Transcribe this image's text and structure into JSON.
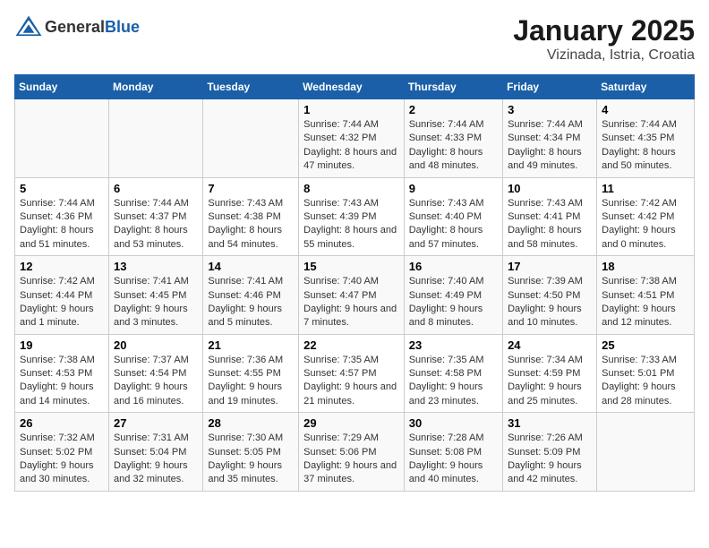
{
  "header": {
    "logo": {
      "general": "General",
      "blue": "Blue"
    },
    "title": "January 2025",
    "subtitle": "Vizinada, Istria, Croatia"
  },
  "weekdays": [
    "Sunday",
    "Monday",
    "Tuesday",
    "Wednesday",
    "Thursday",
    "Friday",
    "Saturday"
  ],
  "weeks": [
    [
      {
        "day": "",
        "sunrise": "",
        "sunset": "",
        "daylight": ""
      },
      {
        "day": "",
        "sunrise": "",
        "sunset": "",
        "daylight": ""
      },
      {
        "day": "",
        "sunrise": "",
        "sunset": "",
        "daylight": ""
      },
      {
        "day": "1",
        "sunrise": "Sunrise: 7:44 AM",
        "sunset": "Sunset: 4:32 PM",
        "daylight": "Daylight: 8 hours and 47 minutes."
      },
      {
        "day": "2",
        "sunrise": "Sunrise: 7:44 AM",
        "sunset": "Sunset: 4:33 PM",
        "daylight": "Daylight: 8 hours and 48 minutes."
      },
      {
        "day": "3",
        "sunrise": "Sunrise: 7:44 AM",
        "sunset": "Sunset: 4:34 PM",
        "daylight": "Daylight: 8 hours and 49 minutes."
      },
      {
        "day": "4",
        "sunrise": "Sunrise: 7:44 AM",
        "sunset": "Sunset: 4:35 PM",
        "daylight": "Daylight: 8 hours and 50 minutes."
      }
    ],
    [
      {
        "day": "5",
        "sunrise": "Sunrise: 7:44 AM",
        "sunset": "Sunset: 4:36 PM",
        "daylight": "Daylight: 8 hours and 51 minutes."
      },
      {
        "day": "6",
        "sunrise": "Sunrise: 7:44 AM",
        "sunset": "Sunset: 4:37 PM",
        "daylight": "Daylight: 8 hours and 53 minutes."
      },
      {
        "day": "7",
        "sunrise": "Sunrise: 7:43 AM",
        "sunset": "Sunset: 4:38 PM",
        "daylight": "Daylight: 8 hours and 54 minutes."
      },
      {
        "day": "8",
        "sunrise": "Sunrise: 7:43 AM",
        "sunset": "Sunset: 4:39 PM",
        "daylight": "Daylight: 8 hours and 55 minutes."
      },
      {
        "day": "9",
        "sunrise": "Sunrise: 7:43 AM",
        "sunset": "Sunset: 4:40 PM",
        "daylight": "Daylight: 8 hours and 57 minutes."
      },
      {
        "day": "10",
        "sunrise": "Sunrise: 7:43 AM",
        "sunset": "Sunset: 4:41 PM",
        "daylight": "Daylight: 8 hours and 58 minutes."
      },
      {
        "day": "11",
        "sunrise": "Sunrise: 7:42 AM",
        "sunset": "Sunset: 4:42 PM",
        "daylight": "Daylight: 9 hours and 0 minutes."
      }
    ],
    [
      {
        "day": "12",
        "sunrise": "Sunrise: 7:42 AM",
        "sunset": "Sunset: 4:44 PM",
        "daylight": "Daylight: 9 hours and 1 minute."
      },
      {
        "day": "13",
        "sunrise": "Sunrise: 7:41 AM",
        "sunset": "Sunset: 4:45 PM",
        "daylight": "Daylight: 9 hours and 3 minutes."
      },
      {
        "day": "14",
        "sunrise": "Sunrise: 7:41 AM",
        "sunset": "Sunset: 4:46 PM",
        "daylight": "Daylight: 9 hours and 5 minutes."
      },
      {
        "day": "15",
        "sunrise": "Sunrise: 7:40 AM",
        "sunset": "Sunset: 4:47 PM",
        "daylight": "Daylight: 9 hours and 7 minutes."
      },
      {
        "day": "16",
        "sunrise": "Sunrise: 7:40 AM",
        "sunset": "Sunset: 4:49 PM",
        "daylight": "Daylight: 9 hours and 8 minutes."
      },
      {
        "day": "17",
        "sunrise": "Sunrise: 7:39 AM",
        "sunset": "Sunset: 4:50 PM",
        "daylight": "Daylight: 9 hours and 10 minutes."
      },
      {
        "day": "18",
        "sunrise": "Sunrise: 7:38 AM",
        "sunset": "Sunset: 4:51 PM",
        "daylight": "Daylight: 9 hours and 12 minutes."
      }
    ],
    [
      {
        "day": "19",
        "sunrise": "Sunrise: 7:38 AM",
        "sunset": "Sunset: 4:53 PM",
        "daylight": "Daylight: 9 hours and 14 minutes."
      },
      {
        "day": "20",
        "sunrise": "Sunrise: 7:37 AM",
        "sunset": "Sunset: 4:54 PM",
        "daylight": "Daylight: 9 hours and 16 minutes."
      },
      {
        "day": "21",
        "sunrise": "Sunrise: 7:36 AM",
        "sunset": "Sunset: 4:55 PM",
        "daylight": "Daylight: 9 hours and 19 minutes."
      },
      {
        "day": "22",
        "sunrise": "Sunrise: 7:35 AM",
        "sunset": "Sunset: 4:57 PM",
        "daylight": "Daylight: 9 hours and 21 minutes."
      },
      {
        "day": "23",
        "sunrise": "Sunrise: 7:35 AM",
        "sunset": "Sunset: 4:58 PM",
        "daylight": "Daylight: 9 hours and 23 minutes."
      },
      {
        "day": "24",
        "sunrise": "Sunrise: 7:34 AM",
        "sunset": "Sunset: 4:59 PM",
        "daylight": "Daylight: 9 hours and 25 minutes."
      },
      {
        "day": "25",
        "sunrise": "Sunrise: 7:33 AM",
        "sunset": "Sunset: 5:01 PM",
        "daylight": "Daylight: 9 hours and 28 minutes."
      }
    ],
    [
      {
        "day": "26",
        "sunrise": "Sunrise: 7:32 AM",
        "sunset": "Sunset: 5:02 PM",
        "daylight": "Daylight: 9 hours and 30 minutes."
      },
      {
        "day": "27",
        "sunrise": "Sunrise: 7:31 AM",
        "sunset": "Sunset: 5:04 PM",
        "daylight": "Daylight: 9 hours and 32 minutes."
      },
      {
        "day": "28",
        "sunrise": "Sunrise: 7:30 AM",
        "sunset": "Sunset: 5:05 PM",
        "daylight": "Daylight: 9 hours and 35 minutes."
      },
      {
        "day": "29",
        "sunrise": "Sunrise: 7:29 AM",
        "sunset": "Sunset: 5:06 PM",
        "daylight": "Daylight: 9 hours and 37 minutes."
      },
      {
        "day": "30",
        "sunrise": "Sunrise: 7:28 AM",
        "sunset": "Sunset: 5:08 PM",
        "daylight": "Daylight: 9 hours and 40 minutes."
      },
      {
        "day": "31",
        "sunrise": "Sunrise: 7:26 AM",
        "sunset": "Sunset: 5:09 PM",
        "daylight": "Daylight: 9 hours and 42 minutes."
      },
      {
        "day": "",
        "sunrise": "",
        "sunset": "",
        "daylight": ""
      }
    ]
  ]
}
